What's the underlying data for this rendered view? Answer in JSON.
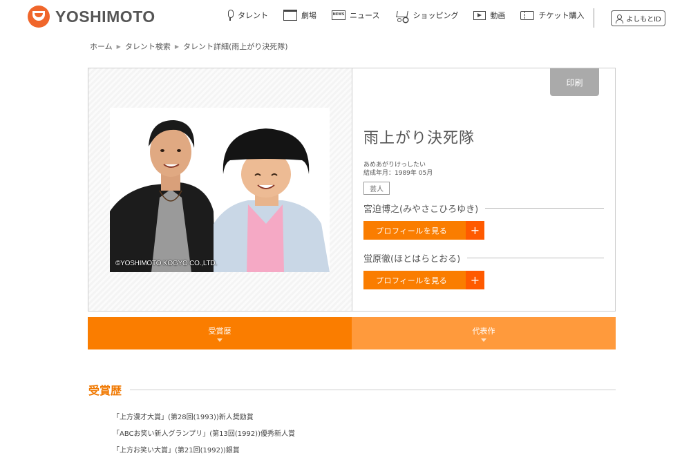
{
  "header": {
    "logo_text": "YOSHIMOTO",
    "nav": [
      {
        "icon": "microphone-icon",
        "label": "タレント"
      },
      {
        "icon": "theater-icon",
        "label": "劇場"
      },
      {
        "icon": "news-icon",
        "label": "ニュース"
      },
      {
        "icon": "cart-icon",
        "label": "ショッピング"
      },
      {
        "icon": "video-icon",
        "label": "動画"
      },
      {
        "icon": "ticket-icon",
        "label": "チケット購入"
      }
    ],
    "news_icon_text": "NEWS",
    "login_label": "よしもとID"
  },
  "breadcrumb": [
    "ホーム",
    "タレント検索",
    "タレント詳細(雨上がり決死隊)"
  ],
  "profile": {
    "copyright": "©YOSHIMOTO KOGYO CO.,LTD.",
    "print_label": "印刷",
    "name": "雨上がり決死隊",
    "reading": "あめあがりけっしたい",
    "formed": "結成年月：1989年 05月",
    "tag": "芸人",
    "members": [
      {
        "name": "宮迫博之(みやさこひろゆき)",
        "button": "プロフィールを見る",
        "plus": "+"
      },
      {
        "name": "蛍原徹(ほとはらとおる)",
        "button": "プロフィールを見る",
        "plus": "+"
      }
    ]
  },
  "tabs": [
    {
      "label": "受賞歴",
      "active": true
    },
    {
      "label": "代表作",
      "active": false
    }
  ],
  "awards": {
    "title": "受賞歴",
    "items": [
      "「上方漫才大賞」(第28回(1993))新人奨励賞",
      "「ABCお笑い新人グランプリ」(第13回(1992))優秀新人賞",
      "「上方お笑い大賞」(第21回(1992))銀賞"
    ]
  },
  "colors": {
    "accent": "#fa7d00",
    "accent_dark": "#ff5a00",
    "accent_light": "#ff9a3c",
    "title_orange": "#f07800",
    "logo": "#f0662b"
  }
}
